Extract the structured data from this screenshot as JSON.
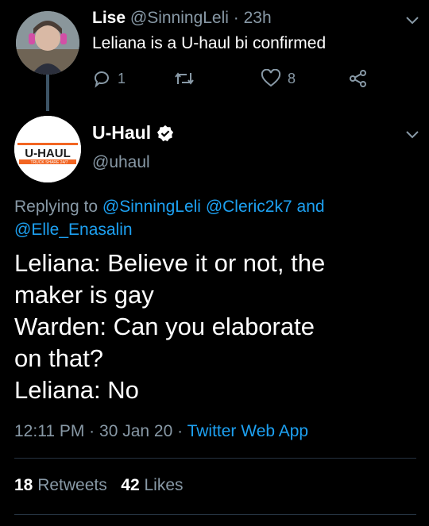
{
  "reply": {
    "name": "Lise",
    "handle": "@SinningLeli",
    "time": "23h",
    "text": "Leliana is a U-haul bi confirmed",
    "reply_count": "1",
    "like_count": "8"
  },
  "tweet": {
    "name": "U-Haul",
    "handle": "@uhaul",
    "logo_text": "U-HAUL",
    "logo_subtext": "TRUCK SHARE 24/7",
    "replying_prefix": "Replying to",
    "mention1": "@SinningLeli",
    "mention2": "@Cleric2k7",
    "and": "and",
    "mention3": "@Elle_Enasalin",
    "lines": [
      "Leliana: Believe it or not, the",
      "maker is gay",
      "Warden: Can you elaborate",
      "on that?",
      "Leliana: No"
    ],
    "time": "12:11 PM",
    "date": "30 Jan 20",
    "source": "Twitter Web App",
    "retweets_count": "18",
    "retweets_label": "Retweets",
    "likes_count": "42",
    "likes_label": "Likes"
  },
  "colors": {
    "background": "#000000",
    "link": "#1da1f2",
    "muted": "#8899a6",
    "uhaul_orange": "#f26522"
  }
}
